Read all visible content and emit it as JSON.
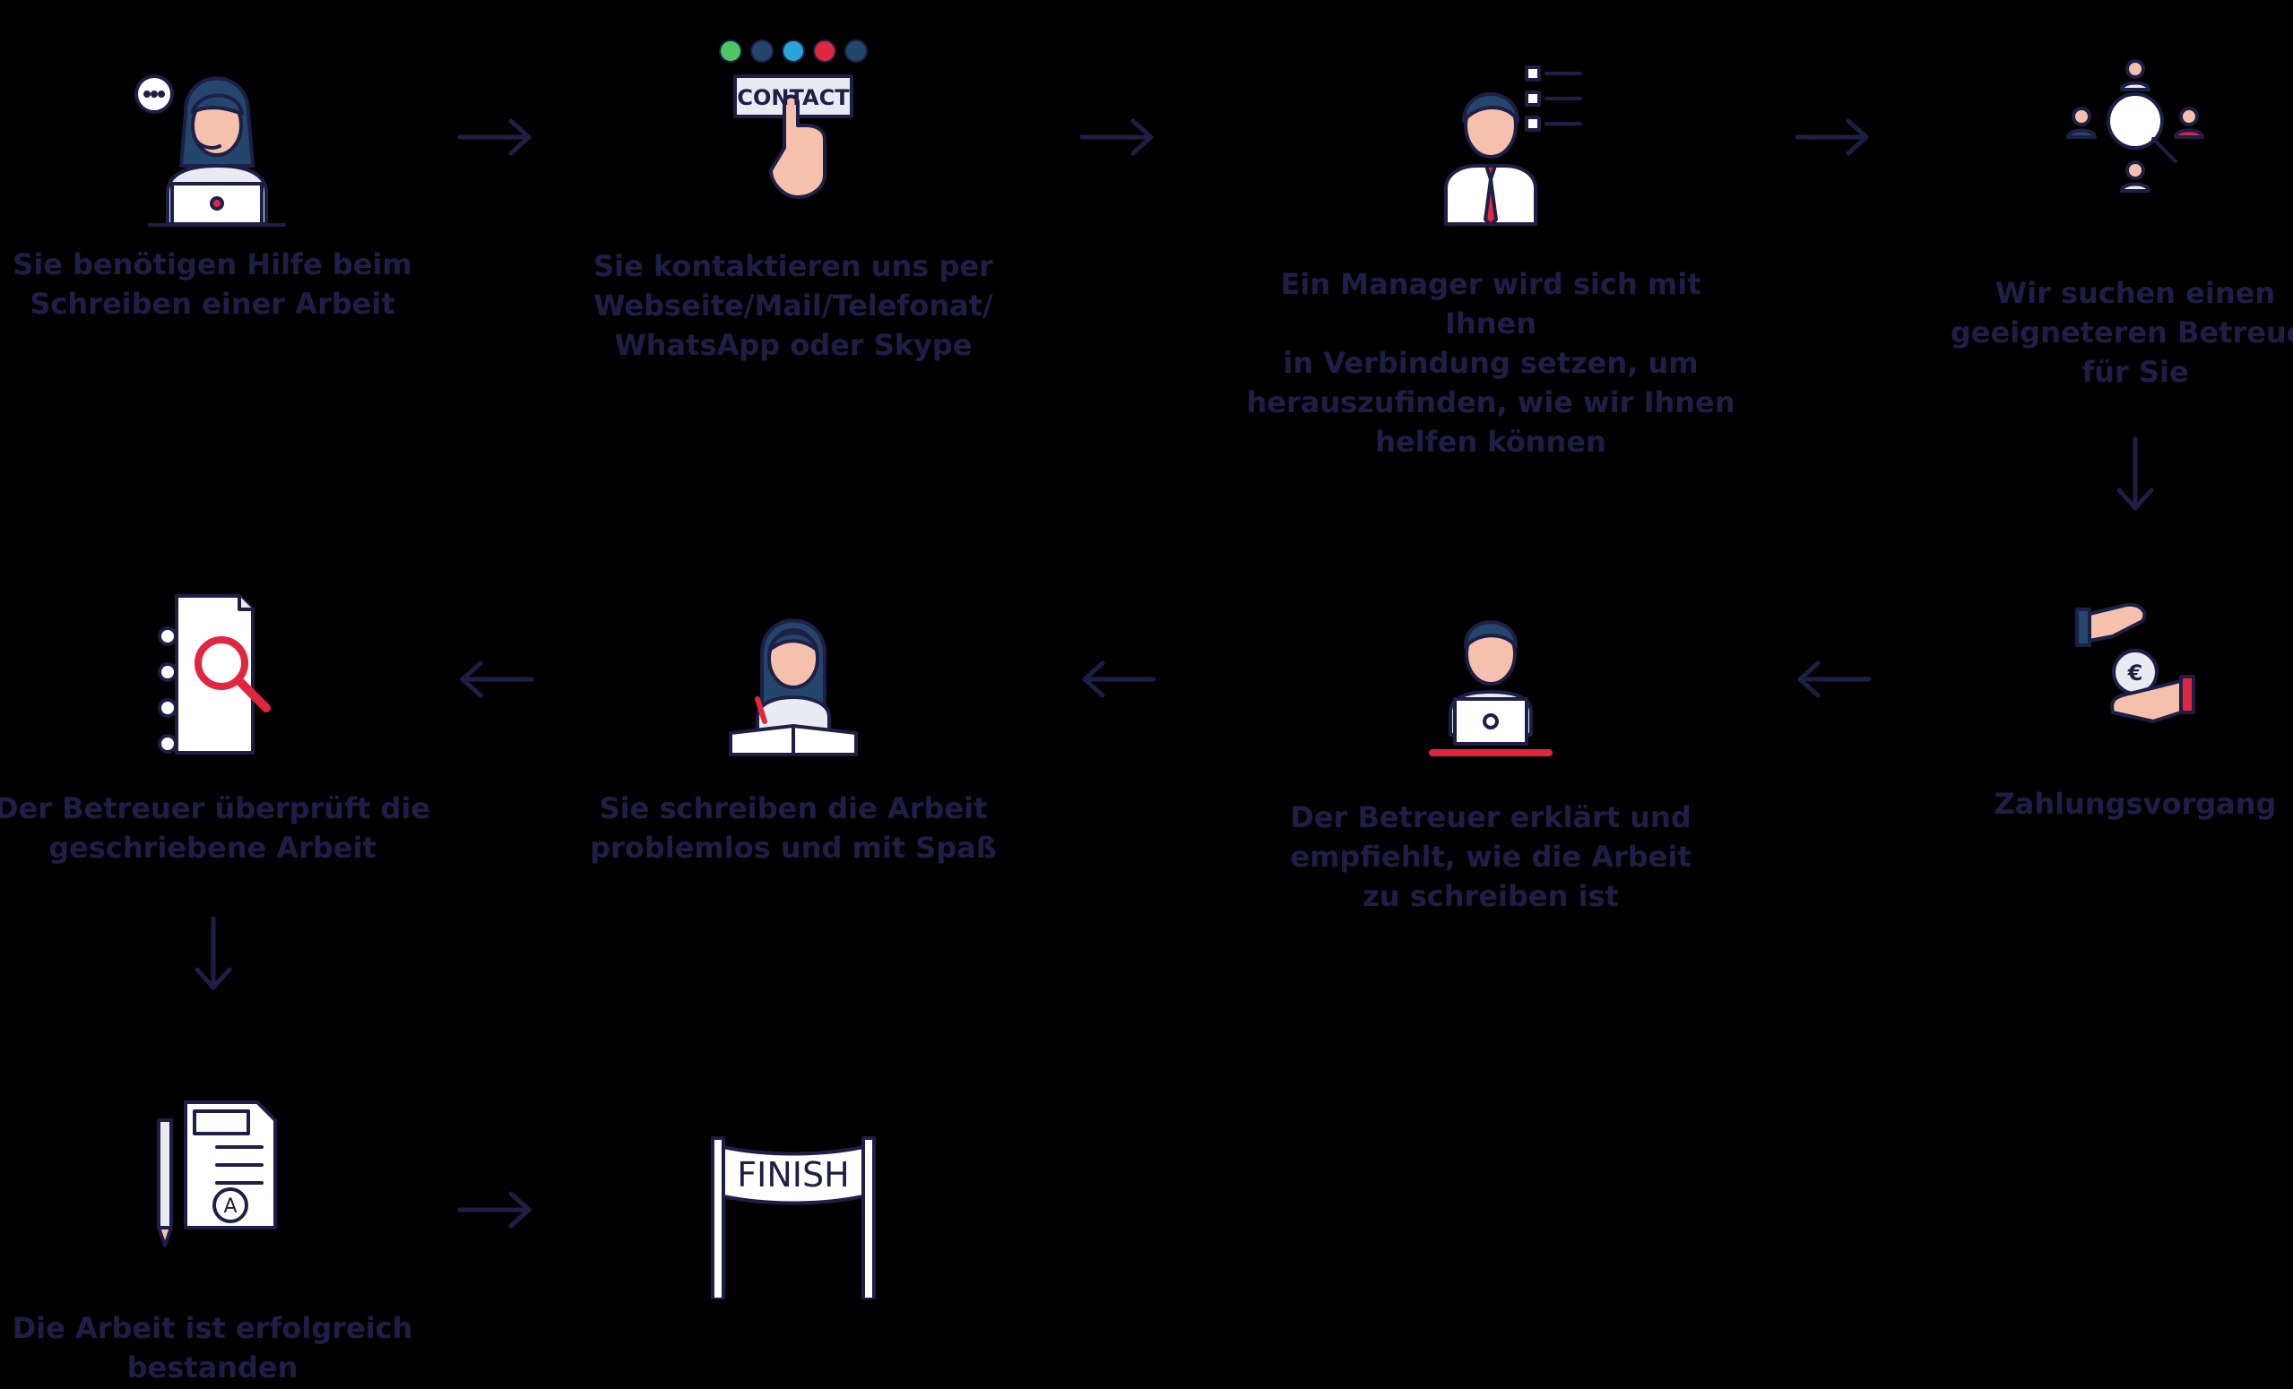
{
  "colors": {
    "background": "#000000",
    "text": "#1e1f47",
    "icon_outline": "#1e1f47",
    "accent_red": "#e0273f",
    "skin": "#f6c1ac",
    "hair_blue": "#24456c",
    "light_gray": "#e8ebf2"
  },
  "steps": [
    {
      "icon": "support-agent-icon",
      "label": "Sie benötigen Hilfe beim\nSchreiben einer Arbeit"
    },
    {
      "icon": "contact-button-icon",
      "label": "Sie kontaktieren uns per\nWebseite/Mail/Telefonat/\nWhatsApp oder Skype",
      "icon_text": "CONTACT"
    },
    {
      "icon": "manager-checklist-icon",
      "label": "Ein Manager wird sich mit Ihnen\nin Verbindung setzen, um\nherauszufinden, wie wir Ihnen\nhelfen können"
    },
    {
      "icon": "search-people-icon",
      "label": "Wir suchen einen\ngeeigneteren Betreuer\nfür Sie"
    },
    {
      "icon": "payment-euro-icon",
      "label": "Zahlungsvorgang"
    },
    {
      "icon": "tutor-laptop-icon",
      "label": "Der Betreuer erklärt und\nempfiehlt, wie die Arbeit\nzu schreiben ist"
    },
    {
      "icon": "student-writing-icon",
      "label": "Sie schreiben die Arbeit\nproblemlos und mit Spaß"
    },
    {
      "icon": "document-review-icon",
      "label": "Der Betreuer überprüft die\ngeschriebene Arbeit"
    },
    {
      "icon": "graded-document-icon",
      "label": "Die Arbeit ist erfolgreich\nbestanden"
    },
    {
      "icon": "finish-banner-icon",
      "label": "",
      "icon_text": "FINISH"
    }
  ],
  "arrows": [
    {
      "from": 1,
      "to": 2,
      "direction": "right"
    },
    {
      "from": 2,
      "to": 3,
      "direction": "right"
    },
    {
      "from": 3,
      "to": 4,
      "direction": "right"
    },
    {
      "from": 4,
      "to": 5,
      "direction": "down"
    },
    {
      "from": 5,
      "to": 6,
      "direction": "left"
    },
    {
      "from": 6,
      "to": 7,
      "direction": "left"
    },
    {
      "from": 7,
      "to": 8,
      "direction": "left"
    },
    {
      "from": 8,
      "to": 9,
      "direction": "down"
    },
    {
      "from": 9,
      "to": 10,
      "direction": "right"
    }
  ]
}
